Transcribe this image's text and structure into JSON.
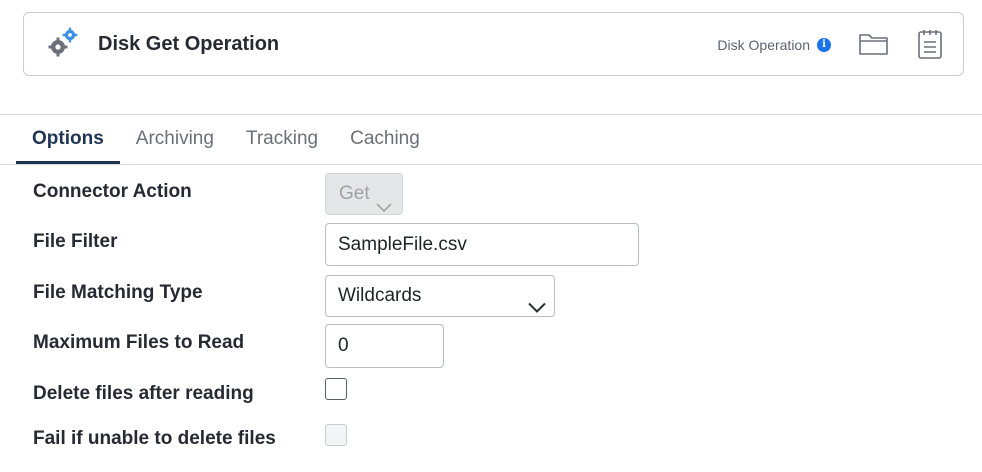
{
  "header": {
    "title": "Disk Get Operation",
    "operation_type": "Disk Operation",
    "info_glyph": "i",
    "icons": [
      "gears-icon",
      "info-icon",
      "folder-icon",
      "notes-icon"
    ],
    "accent_color": "#1a73e8"
  },
  "tabs": [
    {
      "label": "Options",
      "active": true
    },
    {
      "label": "Archiving",
      "active": false
    },
    {
      "label": "Tracking",
      "active": false
    },
    {
      "label": "Caching",
      "active": false
    }
  ],
  "form": {
    "connector_action": {
      "label": "Connector Action",
      "value": "Get",
      "disabled": true
    },
    "file_filter": {
      "label": "File Filter",
      "value": "SampleFile.csv"
    },
    "file_matching_type": {
      "label": "File Matching Type",
      "value": "Wildcards"
    },
    "max_files": {
      "label": "Maximum Files to Read",
      "value": "0"
    },
    "delete_after": {
      "label": "Delete files after reading",
      "checked": false
    },
    "fail_delete": {
      "label": "Fail if unable to delete files",
      "checked": false,
      "disabled": true
    }
  }
}
